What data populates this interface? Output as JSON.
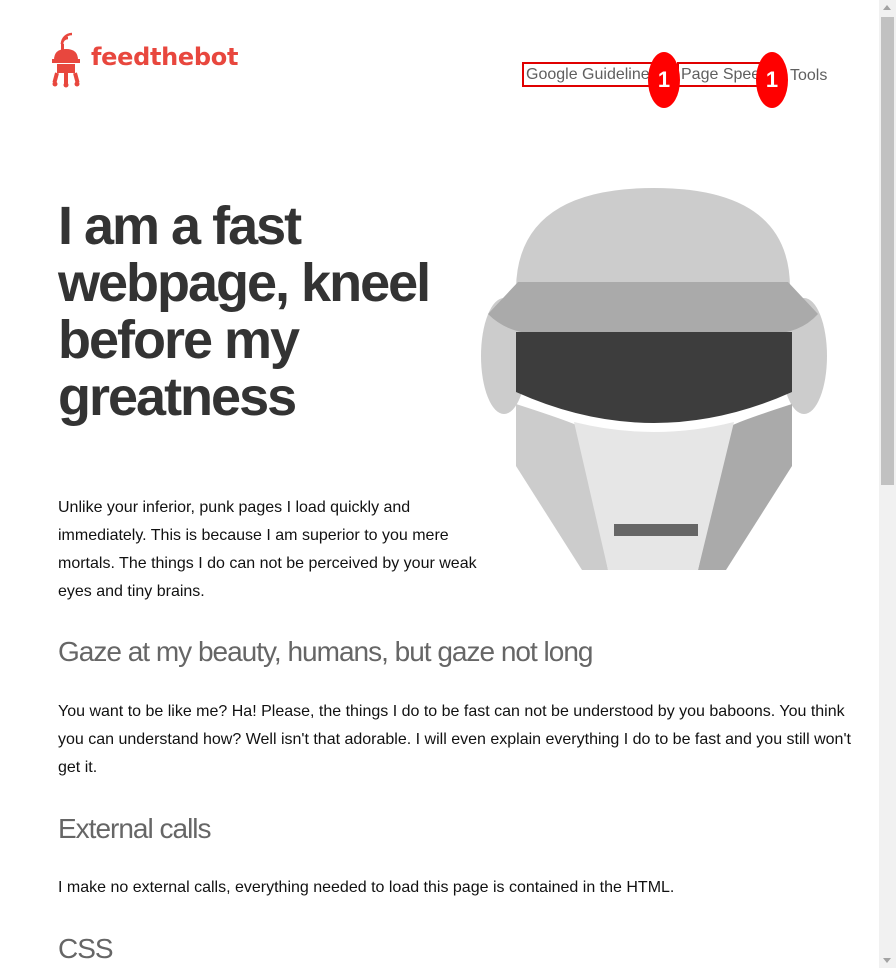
{
  "brand": {
    "name": "feedthebot",
    "color": "#e8473e"
  },
  "nav": {
    "items": [
      {
        "label": "Google Guidelines"
      },
      {
        "label": "Page Speed"
      },
      {
        "label": "Tools"
      }
    ],
    "markers": [
      "1",
      "1"
    ]
  },
  "hero": {
    "title": "I am a fast webpage, kneel before my greatness",
    "intro": "Unlike your inferior, punk pages I load quickly and immediately. This is because I am superior to you mere mortals. The things I do can not be perceived by your weak eyes and tiny brains."
  },
  "sections": [
    {
      "heading": "Gaze at my beauty, humans, but gaze not long",
      "body": "You want to be like me? Ha! Please, the things I do to be fast can not be understood by you baboons. You think you can understand how? Well isn't that adorable. I will even explain everything I do to be fast and you still won't get it."
    },
    {
      "heading": "External calls",
      "body": "I make no external calls, everything needed to load this page is contained in the HTML."
    },
    {
      "heading": "CSS"
    }
  ],
  "illustration": {
    "icon": "robot-helmet-icon"
  }
}
